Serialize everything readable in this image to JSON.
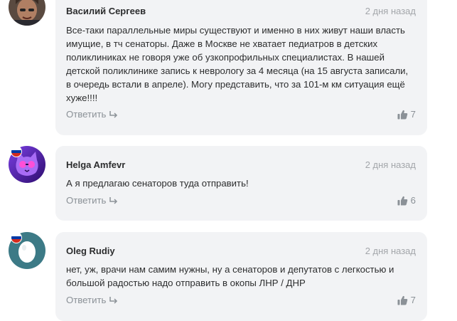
{
  "comments": [
    {
      "author": "Василий Сергеев",
      "time": "2 дня назад",
      "text": "Все-таки параллельные миры существуют и именно в них живут наши власть имущие, в тч сенаторы. Даже в Москве не хватает педиатров в детских поликлиниках не говоря уже об узкопрофильных специалистах. В нашей детской поликлинике запись к неврологу за 4 месяца (на 15 августа записали, в очередь встали в апреле). Могу представить, что за 101-м км ситуация ещё хуже!!!!",
      "reply_label": "Ответить",
      "likes": "7"
    },
    {
      "author": "Helga Amfevr",
      "time": "2 дня назад",
      "text": "А я предлагаю сенаторов туда отправить!",
      "reply_label": "Ответить",
      "likes": "6"
    },
    {
      "author": "Oleg Rudiy",
      "time": "2 дня назад",
      "text": "нет, уж, врачи нам самим нужны, ну а сенаторов и депутатов с легкостью и большой радостью надо отправить в окопы ЛНР / ДНР",
      "reply_label": "Ответить",
      "likes": "7"
    }
  ],
  "colors": {
    "bubble_bg": "#f2f3f5",
    "author": "#2c2d2e",
    "muted": "#8b9197",
    "time": "#a3a6aa"
  },
  "icons": {
    "reply": "reply-arrow-icon",
    "like": "thumbs-up-icon",
    "flag": "russia-flag-icon"
  }
}
